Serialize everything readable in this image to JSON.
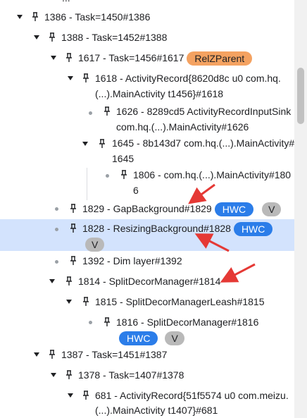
{
  "tree": {
    "top_partial_label": "...",
    "rows": [
      {
        "label": "1386 - Task=1450#1386",
        "expanded": true,
        "has_children": true
      },
      {
        "label": "1388 - Task=1452#1388",
        "expanded": true,
        "has_children": true
      },
      {
        "label": "1617 - Task=1456#1617",
        "expanded": true,
        "has_children": true,
        "chip": "RelZParent"
      },
      {
        "label_lines": [
          "1618 - ActivityRecord{8620d8c u0 com.hq.",
          "(...).MainActivity t1456}#1618"
        ],
        "expanded": true,
        "has_children": true
      },
      {
        "label_lines": [
          "1626 - 8289cd5 ActivityRecordInputSink",
          "com.hq.(...).MainActivity#1626"
        ],
        "has_children": false
      },
      {
        "label_lines": [
          "1645 - 8b143d7 com.hq.(...).MainActivity#",
          "1645"
        ],
        "expanded": true,
        "has_children": true
      },
      {
        "label_lines": [
          "1806 - com.hq.(...).MainActivity#180",
          "6"
        ],
        "has_children": false
      },
      {
        "label": "1829 - GapBackground#1829",
        "has_children": false,
        "chips": [
          "HWC",
          "V"
        ]
      },
      {
        "label": "1828 - ResizingBackground#1828",
        "has_children": false,
        "selected": true,
        "chips": [
          "HWC",
          "V"
        ]
      },
      {
        "label": "1392 - Dim layer#1392",
        "has_children": false
      },
      {
        "label": "1814 - SplitDecorManager#1814",
        "expanded": true,
        "has_children": true
      },
      {
        "label": "1815 - SplitDecorManagerLeash#1815",
        "expanded": true,
        "has_children": true
      },
      {
        "label": "1816 - SplitDecorManager#1816",
        "has_children": false,
        "chips": [
          "HWC",
          "V"
        ]
      },
      {
        "label": "1387 - Task=1451#1387",
        "expanded": true,
        "has_children": true
      },
      {
        "label": "1378 - Task=1407#1378",
        "expanded": true,
        "has_children": true
      },
      {
        "label_lines": [
          "681 - ActivityRecord{51f5574 u0 com.meizu.",
          "(...).MainActivity t1407}#681"
        ],
        "expanded": true,
        "has_children": true
      }
    ]
  },
  "colors": {
    "selected_row": "#d3e3fd",
    "hwc_chip": "#2b7de9",
    "v_chip": "#b9b9b9",
    "relz_chip": "#f4a261",
    "annotation_arrow": "#e53935"
  },
  "icons": {
    "expander": "triangle-down-icon",
    "leaf": "dot-icon",
    "node": "pin-icon"
  }
}
